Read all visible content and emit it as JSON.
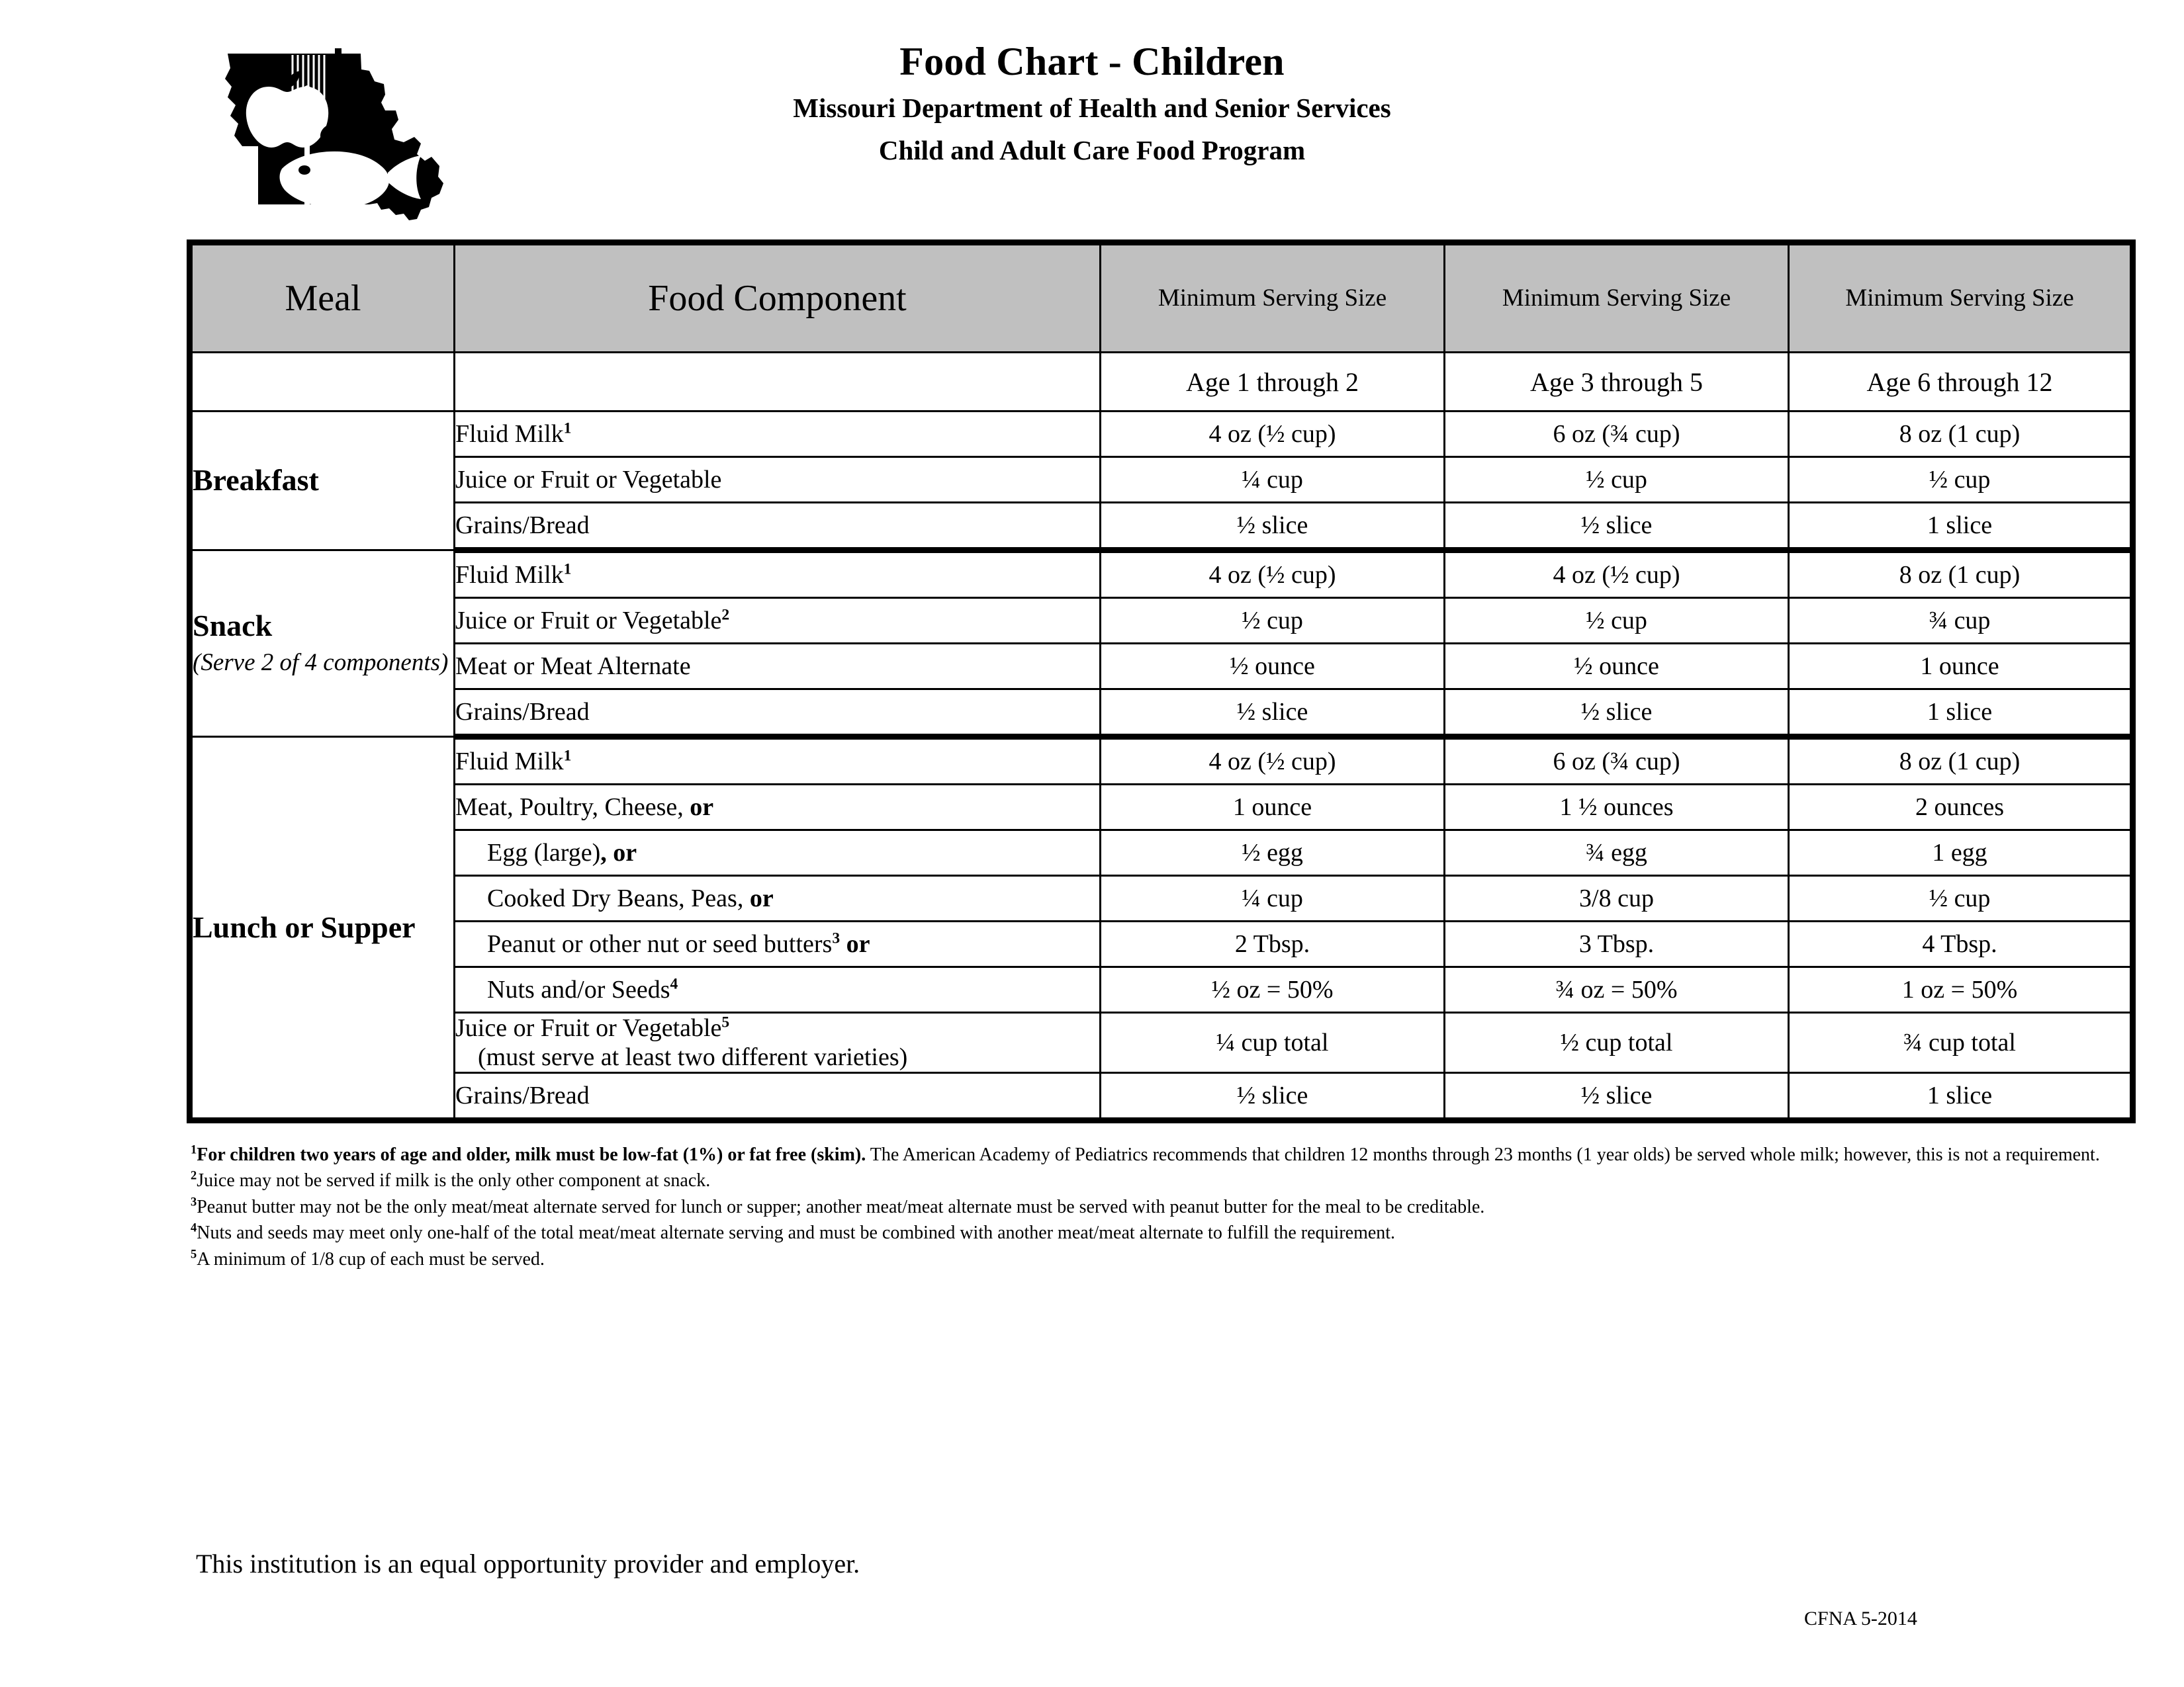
{
  "header": {
    "title": "Food Chart - Children",
    "subtitle_line1": "Missouri Department of Health and Senior Services",
    "subtitle_line2": "Child and Adult Care Food Program",
    "logo_name": "missouri-state-outline-logo"
  },
  "table": {
    "columns": {
      "meal": "Meal",
      "food_component": "Food Component",
      "serving_1": "Minimum Serving Size",
      "serving_2": "Minimum Serving Size",
      "serving_3": "Minimum Serving Size"
    },
    "age_headers": {
      "age_1": "Age 1 through 2",
      "age_2": "Age 3 through 5",
      "age_3": "Age 6 through 12"
    },
    "sections": [
      {
        "meal": "Breakfast",
        "meal_note": "",
        "rows": [
          {
            "component": "Fluid Milk",
            "footnote": "1",
            "indent": false,
            "or_bold": false,
            "paren": "",
            "age1": "4 oz (½ cup)",
            "age2": "6 oz (¾ cup)",
            "age3": "8 oz (1 cup)"
          },
          {
            "component": "Juice or Fruit or Vegetable",
            "footnote": "",
            "indent": false,
            "or_bold": false,
            "paren": "",
            "age1": "¼ cup",
            "age2": "½ cup",
            "age3": "½ cup"
          },
          {
            "component": "Grains/Bread",
            "footnote": "",
            "indent": false,
            "or_bold": false,
            "paren": "",
            "age1": "½ slice",
            "age2": "½ slice",
            "age3": "1 slice"
          }
        ]
      },
      {
        "meal": "Snack",
        "meal_note": "(Serve 2 of 4 components)",
        "rows": [
          {
            "component": "Fluid Milk",
            "footnote": "1",
            "indent": false,
            "or_bold": false,
            "paren": "",
            "age1": "4 oz (½ cup)",
            "age2": "4 oz (½ cup)",
            "age3": "8 oz (1 cup)"
          },
          {
            "component": "Juice or Fruit or Vegetable",
            "footnote": "2",
            "indent": false,
            "or_bold": false,
            "paren": "",
            "age1": "½ cup",
            "age2": "½ cup",
            "age3": "¾ cup"
          },
          {
            "component": "Meat or Meat Alternate",
            "footnote": "",
            "indent": false,
            "or_bold": false,
            "paren": "",
            "age1": "½ ounce",
            "age2": "½ ounce",
            "age3": "1 ounce"
          },
          {
            "component": "Grains/Bread",
            "footnote": "",
            "indent": false,
            "or_bold": false,
            "paren": "",
            "age1": "½ slice",
            "age2": "½ slice",
            "age3": "1 slice"
          }
        ]
      },
      {
        "meal": "Lunch or Supper",
        "meal_note": "",
        "rows": [
          {
            "component": "Fluid Milk",
            "footnote": "1",
            "indent": false,
            "or_bold": false,
            "paren": "",
            "age1": "4 oz (½ cup)",
            "age2": "6 oz (¾ cup)",
            "age3": "8 oz (1 cup)"
          },
          {
            "component": "Meat, Poultry, Cheese, ",
            "footnote": "",
            "indent": false,
            "or_bold": true,
            "paren": "",
            "age1": "1 ounce",
            "age2": "1 ½ ounces",
            "age3": "2 ounces"
          },
          {
            "component": "Egg (large)",
            "footnote": "",
            "indent": true,
            "or_bold": true,
            "or_prefix": ", ",
            "paren": "",
            "age1": "½ egg",
            "age2": "¾ egg",
            "age3": "1 egg"
          },
          {
            "component": "Cooked Dry Beans, Peas, ",
            "footnote": "",
            "indent": true,
            "or_bold": true,
            "paren": "",
            "age1": "¼ cup",
            "age2": "3/8 cup",
            "age3": "½ cup"
          },
          {
            "component": "Peanut or other nut or seed butters",
            "footnote": "3",
            "indent": true,
            "or_bold": true,
            "or_prefix": " ",
            "paren": "",
            "age1": "2 Tbsp.",
            "age2": "3 Tbsp.",
            "age3": "4 Tbsp."
          },
          {
            "component": "Nuts and/or Seeds",
            "footnote": "4",
            "indent": true,
            "or_bold": false,
            "paren": "",
            "age1": "½ oz = 50%",
            "age2": "¾ oz = 50%",
            "age3": "1 oz = 50%"
          },
          {
            "component": "Juice or Fruit or Vegetable",
            "footnote": "5",
            "indent": false,
            "or_bold": false,
            "paren": "(must serve at least two different varieties)",
            "age1": "¼ cup total",
            "age2": "½ cup total",
            "age3": "¾ cup total"
          },
          {
            "component": "Grains/Bread",
            "footnote": "",
            "indent": false,
            "or_bold": false,
            "paren": "",
            "age1": "½ slice",
            "age2": "½ slice",
            "age3": "1 slice"
          }
        ]
      }
    ]
  },
  "footnotes": {
    "f1_marker": "1",
    "f1_bold": "For children two years of age and older, milk must be low-fat (1%) or fat free (skim).",
    "f1_rest": " The American Academy of Pediatrics recommends that children 12 months through 23 months (1 year olds) be served whole milk; however, this is not a requirement.",
    "f2_marker": "2",
    "f2_text": "Juice may not be served if milk is the only other component at snack.",
    "f3_marker": "3",
    "f3_text": "Peanut butter may not be the only meat/meat alternate served for lunch or supper; another meat/meat alternate must be served with peanut butter for the meal to be creditable.",
    "f4_marker": "4",
    "f4_text": "Nuts and seeds may meet only one-half of the total meat/meat alternate serving and must be combined with another meat/meat alternate to fulfill the requirement.",
    "f5_marker": "5",
    "f5_text": "A minimum of 1/8 cup of each must be served."
  },
  "bottom": {
    "equal_opportunity": "This institution is an equal opportunity provider and employer.",
    "form_code": "CFNA 5-2014"
  },
  "colors": {
    "header_fill": "#C0C0C0",
    "border": "#000000",
    "text": "#000000",
    "page_background": "#FFFFFF"
  }
}
